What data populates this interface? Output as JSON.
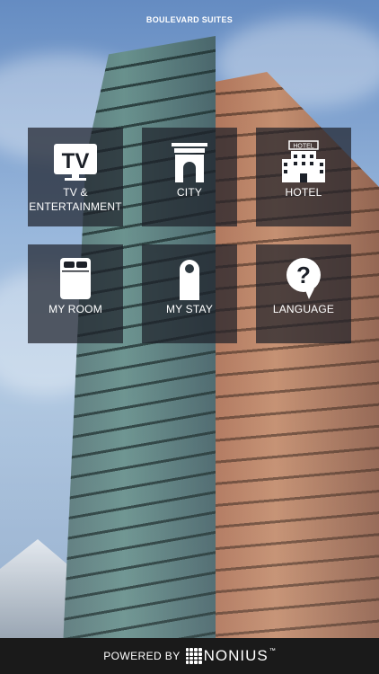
{
  "header": {
    "brand": "BOULEVARD SUITES"
  },
  "tiles": [
    {
      "label_line1": "TV &",
      "label_line2": "ENTERTAINMENT",
      "icon": "tv-icon"
    },
    {
      "label": "CITY",
      "icon": "arch-icon"
    },
    {
      "label": "HOTEL",
      "icon_text": "HOTEL",
      "icon": "hotel-building-icon"
    },
    {
      "label": "MY ROOM",
      "icon": "bed-icon"
    },
    {
      "label": "MY STAY",
      "icon": "door-hanger-icon"
    },
    {
      "label": "LANGUAGE",
      "icon": "question-bubble-icon"
    }
  ],
  "footer": {
    "powered_by": "POWERED BY",
    "brand": "NONIUS",
    "trademark": "™"
  },
  "colors": {
    "tile_bg": "#1c2028",
    "footer_bg": "#1a1a1a",
    "text": "#ffffff"
  }
}
